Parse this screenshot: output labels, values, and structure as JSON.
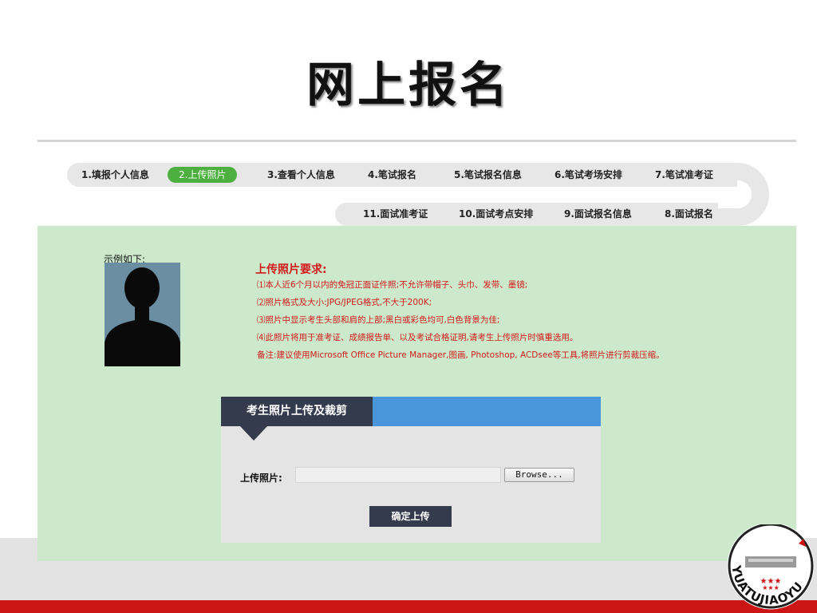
{
  "page_title": "网上报名",
  "steps_top": [
    {
      "label": "1.填报个人信息",
      "active": false
    },
    {
      "label": "2.上传照片",
      "active": true
    },
    {
      "label": "3.查看个人信息",
      "active": false
    },
    {
      "label": "4.笔试报名",
      "active": false
    },
    {
      "label": "5.笔试报名信息",
      "active": false
    },
    {
      "label": "6.笔试考场安排",
      "active": false
    },
    {
      "label": "7.笔试准考证",
      "active": false
    }
  ],
  "steps_bottom": [
    {
      "label": "11.面试准考证"
    },
    {
      "label": "10.面试考点安排"
    },
    {
      "label": "9.面试报名信息"
    },
    {
      "label": "8.面试报名"
    }
  ],
  "example": {
    "label": "示例如下:"
  },
  "requirements": {
    "title": "上传照片要求:",
    "lines": [
      "⑴本人近6个月以内的免冠正面证件照;不允许带帽子、头巾、发带、墨镜;",
      "⑵照片格式及大小:JPG/JPEG格式,不大于200K;",
      "⑶照片中显示考生头部和肩的上部;黑白或彩色均可,白色背景为佳;",
      "⑷此照片将用于准考证、成绩报告单、以及考试合格证明,请考生上传照片时慎重选用。",
      "备注:建议使用Microsoft Office Picture Manager,图画, Photoshop, ACDsee等工具,将照片进行剪裁压缩。"
    ]
  },
  "upload_panel": {
    "title": "考生照片上传及裁剪",
    "field_label": "上传照片:",
    "browse_label": "Browse...",
    "submit_label": "确定上传"
  },
  "logo": {
    "text": "YUATUJIAOYU"
  },
  "colors": {
    "active_step": "#4caf3f",
    "content_bg": "#cce9cc",
    "requirement_text": "#d41a1a",
    "panel_tab": "#343b4c",
    "panel_header": "#4a96da",
    "footer_red": "#cc1515"
  }
}
